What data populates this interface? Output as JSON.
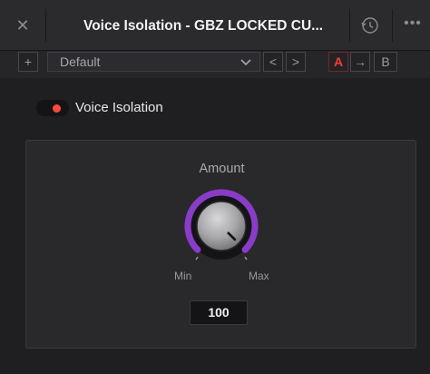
{
  "window": {
    "title": "Voice Isolation - GBZ LOCKED CU...",
    "close_icon": "close-icon",
    "history_icon": "history-icon",
    "more_icon": "more-dots-icon"
  },
  "toolbar": {
    "add_label": "+",
    "preset_value": "Default",
    "prev_label": "<",
    "next_label": ">",
    "ab_a_label": "A",
    "ab_copy_label": "→",
    "ab_b_label": "B"
  },
  "effect": {
    "toggle_label": "Voice Isolation",
    "enabled": true
  },
  "control": {
    "label": "Amount",
    "min_label": "Min",
    "max_label": "Max",
    "value": "100",
    "level": 1.0
  },
  "colors": {
    "accent_purple": "#8a3cc9",
    "toggle_on": "#ff4a3d",
    "ab_active": "#ff3b30"
  }
}
